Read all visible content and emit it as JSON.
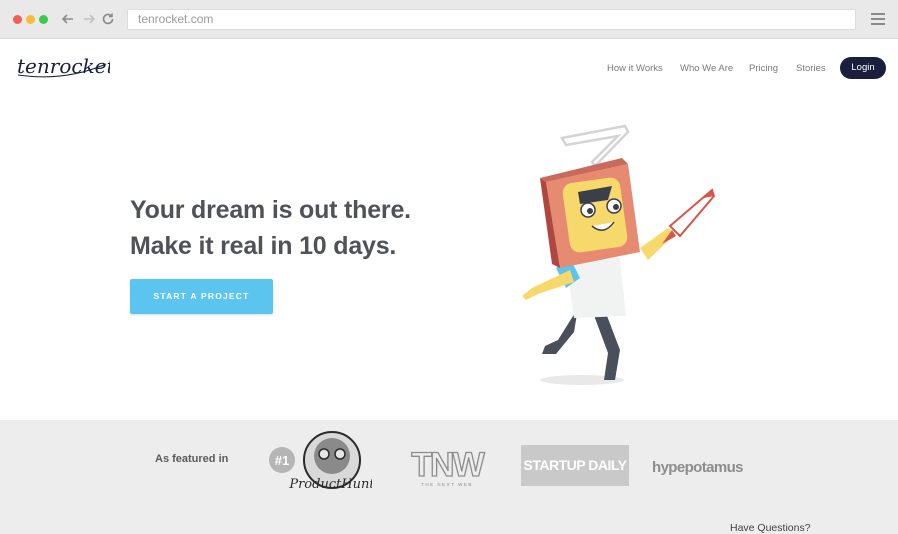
{
  "browser": {
    "url": "tenrocket.com",
    "icons": [
      "back-arrow-icon",
      "forward-arrow-icon",
      "reload-icon",
      "hamburger-menu-icon"
    ]
  },
  "header": {
    "logo_text": "tenrocket",
    "nav": [
      "How it Works",
      "Who We Are",
      "Pricing",
      "Stories"
    ],
    "login_label": "Login"
  },
  "hero": {
    "line1": "Your dream is out there.",
    "line2": "Make it real in 10 days.",
    "cta_label": "START A PROJECT"
  },
  "featured": {
    "label": "As featured in",
    "logos": {
      "product_hunt_badge": "#1",
      "product_hunt": "ProductHunt",
      "tnw": "TNW",
      "tnw_tagline": "THE NEXT WEB",
      "startup_daily": "STARTUP DAILY",
      "hypepotamus": "hypepotamus"
    }
  },
  "footer": {
    "have_questions": "Have Questions?"
  },
  "colors": {
    "cta": "#5bc5ef",
    "login": "#1a1f3e",
    "headline": "#4f5259",
    "band": "#ededed"
  }
}
